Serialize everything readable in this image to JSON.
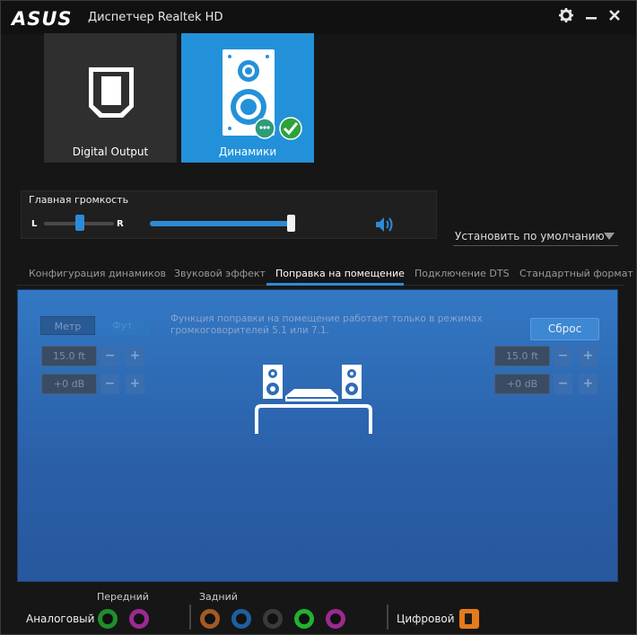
{
  "titlebar": {
    "brand": "ASUS",
    "title": "Диспетчер Realtek HD"
  },
  "devices": [
    {
      "label": "Digital Output",
      "icon": "digital-output-icon",
      "selected": false
    },
    {
      "label": "Динамики",
      "icon": "speakers-icon",
      "selected": true
    }
  ],
  "volume": {
    "title": "Главная громкость",
    "left_label": "L",
    "right_label": "R",
    "balance": 0.5,
    "level": 0.98
  },
  "default_dropdown": {
    "label": "Установить по умолчанию"
  },
  "tabs": [
    {
      "label": "Конфигурация динамиков"
    },
    {
      "label": "Звуковой эффект"
    },
    {
      "label": "Поправка на помещение",
      "active": true
    },
    {
      "label": "Подключение DTS"
    },
    {
      "label": "Стандартный формат"
    }
  ],
  "room": {
    "unit_meter": "Метр",
    "unit_feet": "Фут",
    "description": "Функция поправки на помещение работает только в режимах громкоговорителей 5.1 или 7.1.",
    "reset_label": "Сброс",
    "left": {
      "distance": "15.0 ft",
      "gain": "+0 dB"
    },
    "right": {
      "distance": "15.0 ft",
      "gain": "+0 dB"
    },
    "minus": "−",
    "plus": "+"
  },
  "jacks": {
    "analog_label": "Аналоговый",
    "front_label": "Передний",
    "rear_label": "Задний",
    "digital_label": "Цифровой",
    "front_colors": [
      "#1f8f2a",
      "#9b2a8f"
    ],
    "rear_colors": [
      "#a25a24",
      "#1f5f9e",
      "#3a3a3a",
      "#22b22e",
      "#9b2a8f"
    ]
  },
  "colors": {
    "accent": "#2d8bd6",
    "panel_bg": "#2f6cb8"
  }
}
